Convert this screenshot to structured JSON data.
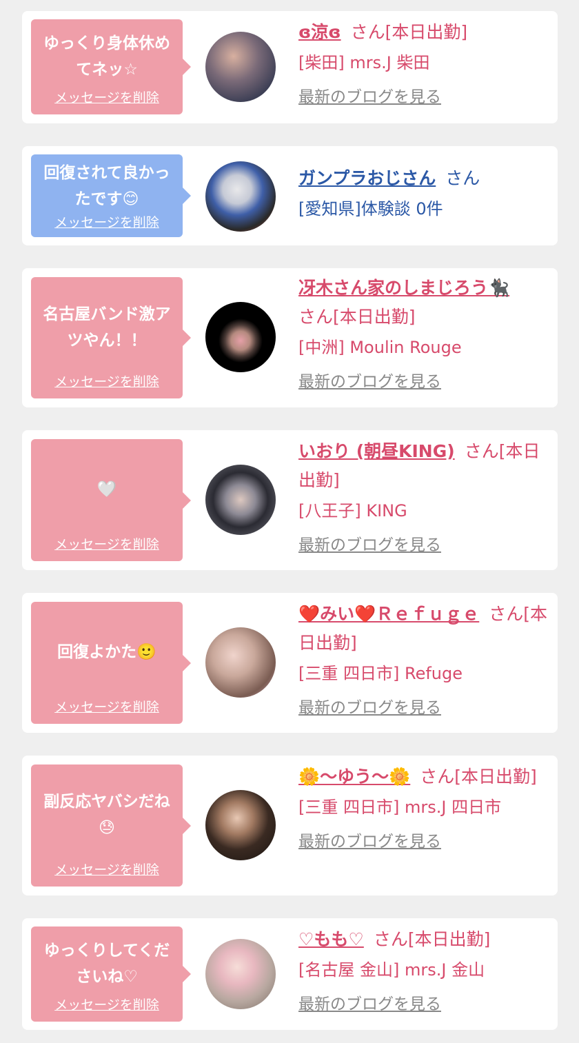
{
  "colors": {
    "background": "#efefef",
    "bubble_pink": "#ef9ea9",
    "bubble_blue": "#8fb3f0",
    "text_pink": "#d74a6b",
    "text_blue": "#2b58a6",
    "link_gray": "#888888"
  },
  "cards": [
    {
      "message": "ゆっくり身体休めてネッ☆",
      "delete_label": "メッセージを削除",
      "name": "ɞ涼ɞ",
      "status": "さん[本日出勤]",
      "shop": "[柴田] mrs.J 柴田",
      "blog_label": "最新のブログを見る"
    },
    {
      "message": "回復されて良かったです😊",
      "delete_label": "メッセージを削除",
      "name": "ガンプラおじさん",
      "status": "さん",
      "shop": "[愛知県]体験談 0件"
    },
    {
      "message": "名古屋バンド激アツやん！！",
      "delete_label": "メッセージを削除",
      "name": "冴木さん家のしまじろう🐈‍⬛",
      "status": "さん[本日出勤]",
      "shop": "[中洲] Moulin Rouge",
      "blog_label": "最新のブログを見る"
    },
    {
      "message": "🤍",
      "delete_label": "メッセージを削除",
      "name": "いおり (朝昼KING)",
      "status": "さん[本日出勤]",
      "shop": "[八王子] KING",
      "blog_label": "最新のブログを見る"
    },
    {
      "message": "回復よかた🙂",
      "delete_label": "メッセージを削除",
      "name": "❤️みい❤️Ｒｅｆｕｇｅ",
      "status": "さん[本日出勤]",
      "shop": "[三重 四日市] Refuge",
      "blog_label": "最新のブログを見る"
    },
    {
      "message": "副反応ヤバシだね😓",
      "delete_label": "メッセージを削除",
      "name": "🌼〜ゆう〜🌼",
      "status": "さん[本日出勤]",
      "shop": "[三重 四日市] mrs.J 四日市",
      "blog_label": "最新のブログを見る"
    },
    {
      "message": "ゆっくりしてくださいね♡",
      "delete_label": "メッセージを削除",
      "name": "♡もも♡",
      "status": "さん[本日出勤]",
      "shop": "[名古屋 金山] mrs.J 金山",
      "blog_label": "最新のブログを見る"
    }
  ]
}
